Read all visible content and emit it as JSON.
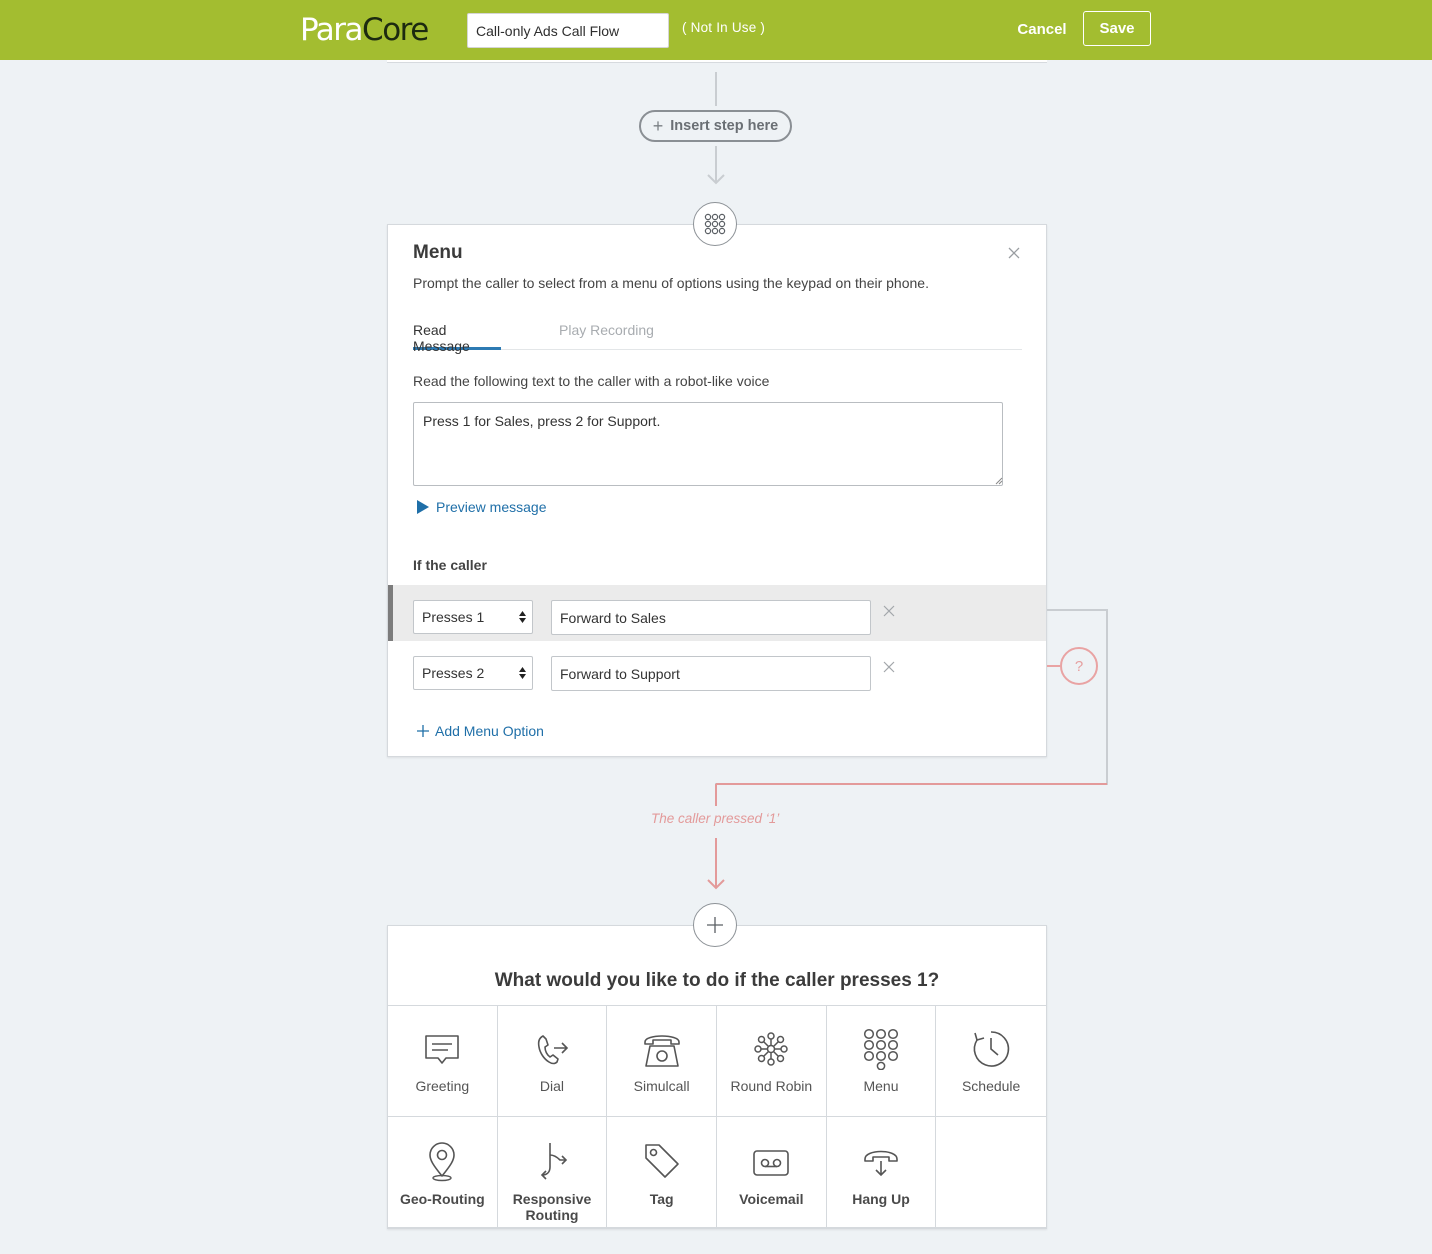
{
  "header": {
    "logo_left": "Para",
    "logo_right": "Core",
    "flow_name": "Call-only Ads Call Flow",
    "status": "( Not In Use )",
    "cancel_label": "Cancel",
    "save_label": "Save",
    "brand_color": "#a3bd30"
  },
  "insert_step": {
    "label": "Insert step here",
    "icon": "plus-icon"
  },
  "menu_step": {
    "icon": "keypad-icon",
    "title": "Menu",
    "description": "Prompt the caller to select from a menu of options using the keypad on their phone.",
    "tabs": [
      {
        "label": "Read Message",
        "active": true
      },
      {
        "label": "Play Recording",
        "active": false
      }
    ],
    "message_label": "Read the following text to the caller with a robot-like voice",
    "message_text": "Press 1 for Sales, press 2 for Support.",
    "preview_label": "Preview message",
    "options_label": "If the caller",
    "options": [
      {
        "press": "Presses 1",
        "action": "Forward to Sales",
        "highlighted": true
      },
      {
        "press": "Presses 2",
        "action": "Forward to Support",
        "highlighted": false
      }
    ],
    "add_option_label": "Add Menu Option"
  },
  "branch": {
    "label": "The caller pressed ‘1’",
    "badge": "?",
    "color": "#e39a9a"
  },
  "action_picker": {
    "title": "What would you like to do if the caller presses 1?",
    "tiles": [
      {
        "label": "Greeting",
        "icon": "message-icon"
      },
      {
        "label": "Dial",
        "icon": "phone-forward-icon"
      },
      {
        "label": "Simulcall",
        "icon": "desk-phone-icon"
      },
      {
        "label": "Round Robin",
        "icon": "round-robin-icon"
      },
      {
        "label": "Menu",
        "icon": "keypad-icon"
      },
      {
        "label": "Schedule",
        "icon": "clock-icon"
      },
      {
        "label": "Geo-Routing",
        "icon": "map-pin-icon"
      },
      {
        "label": "Responsive Routing",
        "icon": "split-arrow-icon"
      },
      {
        "label": "Tag",
        "icon": "tag-icon"
      },
      {
        "label": "Voicemail",
        "icon": "voicemail-icon"
      },
      {
        "label": "Hang Up",
        "icon": "hang-up-icon"
      }
    ]
  }
}
